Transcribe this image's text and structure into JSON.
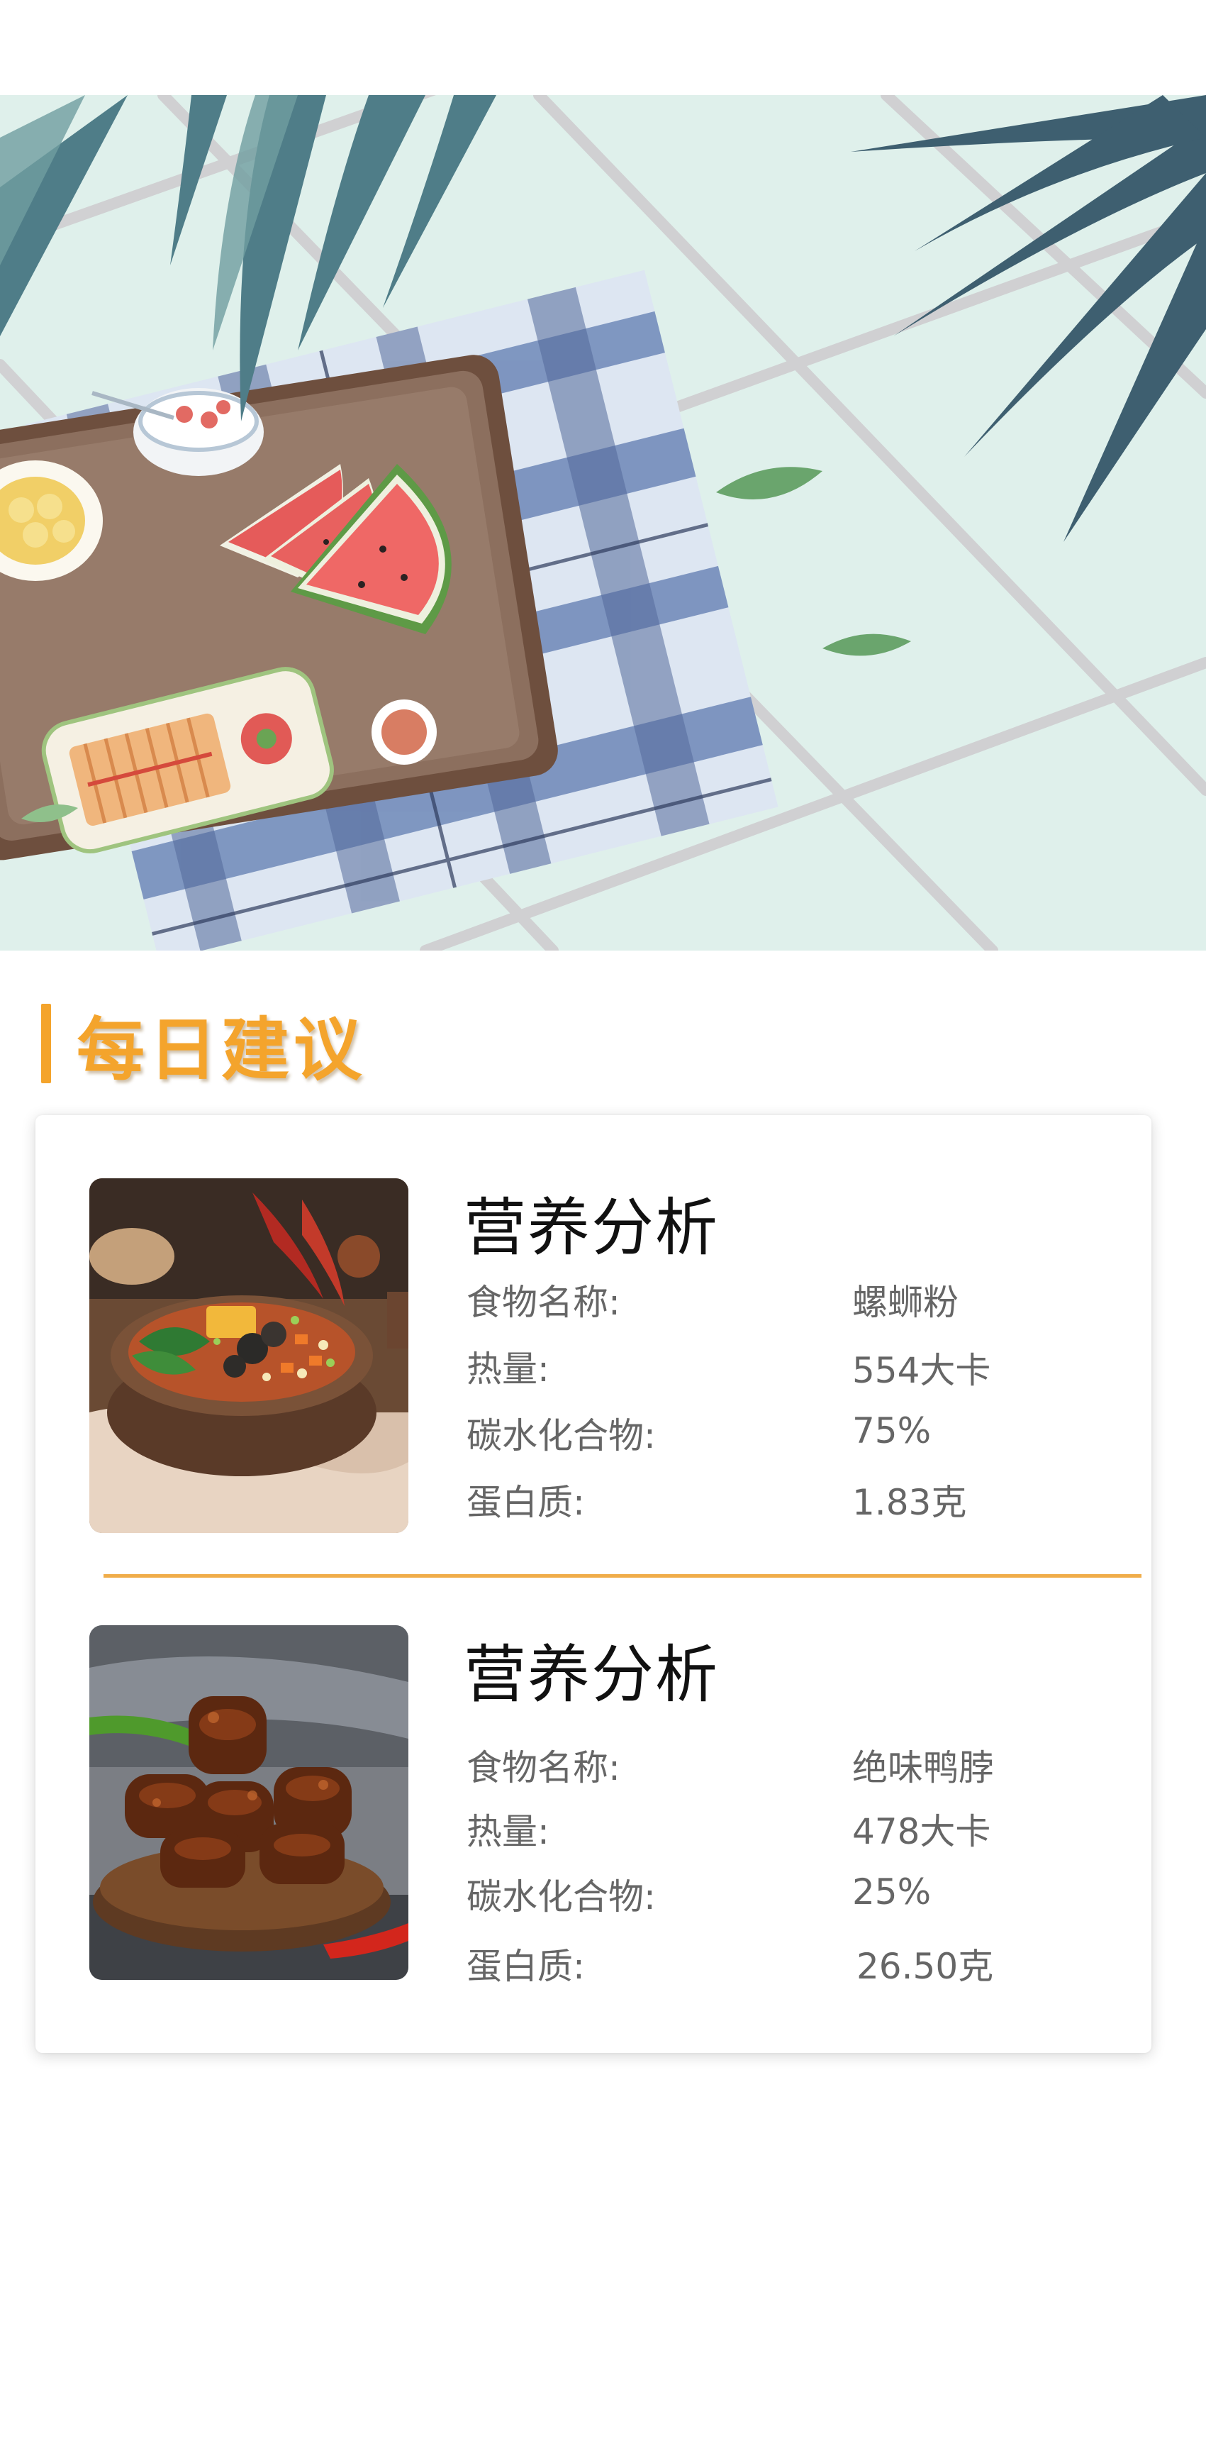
{
  "section": {
    "title": "每日建议"
  },
  "items": [
    {
      "heading": "营养分析",
      "image_icon": "luosifen-bowl-photo",
      "rows": [
        {
          "label": "食物名称:",
          "value": "螺蛳粉"
        },
        {
          "label": "热量:",
          "value": "554大卡"
        },
        {
          "label": "碳水化合物:",
          "value": "75%"
        },
        {
          "label": "蛋白质:",
          "value": "1.83克"
        }
      ]
    },
    {
      "heading": "营养分析",
      "image_icon": "braised-duck-neck-photo",
      "rows": [
        {
          "label": "食物名称:",
          "value": "绝味鸭脖"
        },
        {
          "label": "热量:",
          "value": "478大卡"
        },
        {
          "label": "碳水化合物:",
          "value": "25%"
        },
        {
          "label": "蛋白质:",
          "value": "26.50克"
        }
      ]
    }
  ],
  "colors": {
    "accent": "#f4a42c",
    "divider": "#f0ad4a",
    "heading": "#111111",
    "text": "#666666",
    "hero_background": "#dff0eb"
  }
}
